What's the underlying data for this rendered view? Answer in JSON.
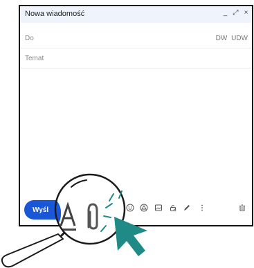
{
  "window": {
    "title": "Nowa wiadomość",
    "controls": [
      "_",
      "⤢",
      "×"
    ]
  },
  "to_field": {
    "label": "Do",
    "cc_label": "DW",
    "bcc_label": "UDW"
  },
  "subject_field": {
    "placeholder": "Temat"
  },
  "toolbar": {
    "send_label": "Wyśl",
    "icons": [
      "format-text-icon",
      "attachment-icon",
      "link-icon",
      "emoji-icon",
      "drive-icon",
      "photo-icon",
      "lock-icon",
      "signature-icon",
      "more-options-icon",
      "trash-icon"
    ]
  },
  "colors": {
    "send_button": "#1a57d6",
    "header_bg": "#eef3fc",
    "cursor": "#1f8a86"
  }
}
